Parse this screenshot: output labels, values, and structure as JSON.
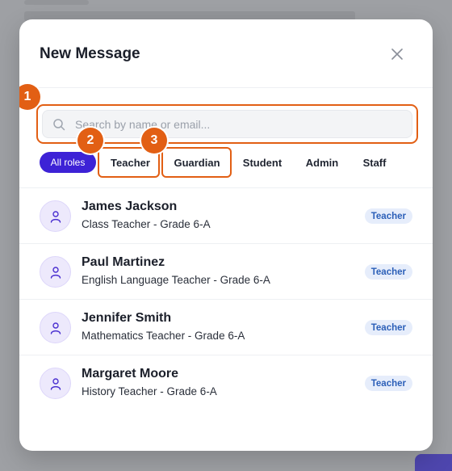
{
  "modal": {
    "title": "New Message"
  },
  "search": {
    "placeholder": "Search by name or email..."
  },
  "filters": [
    {
      "label": "All roles",
      "active": true
    },
    {
      "label": "Teacher",
      "active": false
    },
    {
      "label": "Guardian",
      "active": false
    },
    {
      "label": "Student",
      "active": false
    },
    {
      "label": "Admin",
      "active": false
    },
    {
      "label": "Staff",
      "active": false
    }
  ],
  "annotations": [
    "1",
    "2",
    "3"
  ],
  "contacts": [
    {
      "name": "James Jackson",
      "subtitle": "Class Teacher - Grade 6-A",
      "role": "Teacher"
    },
    {
      "name": "Paul Martinez",
      "subtitle": "English Language Teacher - Grade 6-A",
      "role": "Teacher"
    },
    {
      "name": "Jennifer Smith",
      "subtitle": "Mathematics Teacher - Grade 6-A",
      "role": "Teacher"
    },
    {
      "name": "Margaret Moore",
      "subtitle": "History Teacher - Grade 6-A",
      "role": "Teacher"
    }
  ],
  "colors": {
    "accent": "#3d22d6",
    "highlight": "#e25f14",
    "badge_bg": "#e6edfb",
    "badge_text": "#2b5fb8"
  },
  "icons": {
    "close": "close-icon",
    "search": "search-icon",
    "avatar": "user-icon"
  }
}
